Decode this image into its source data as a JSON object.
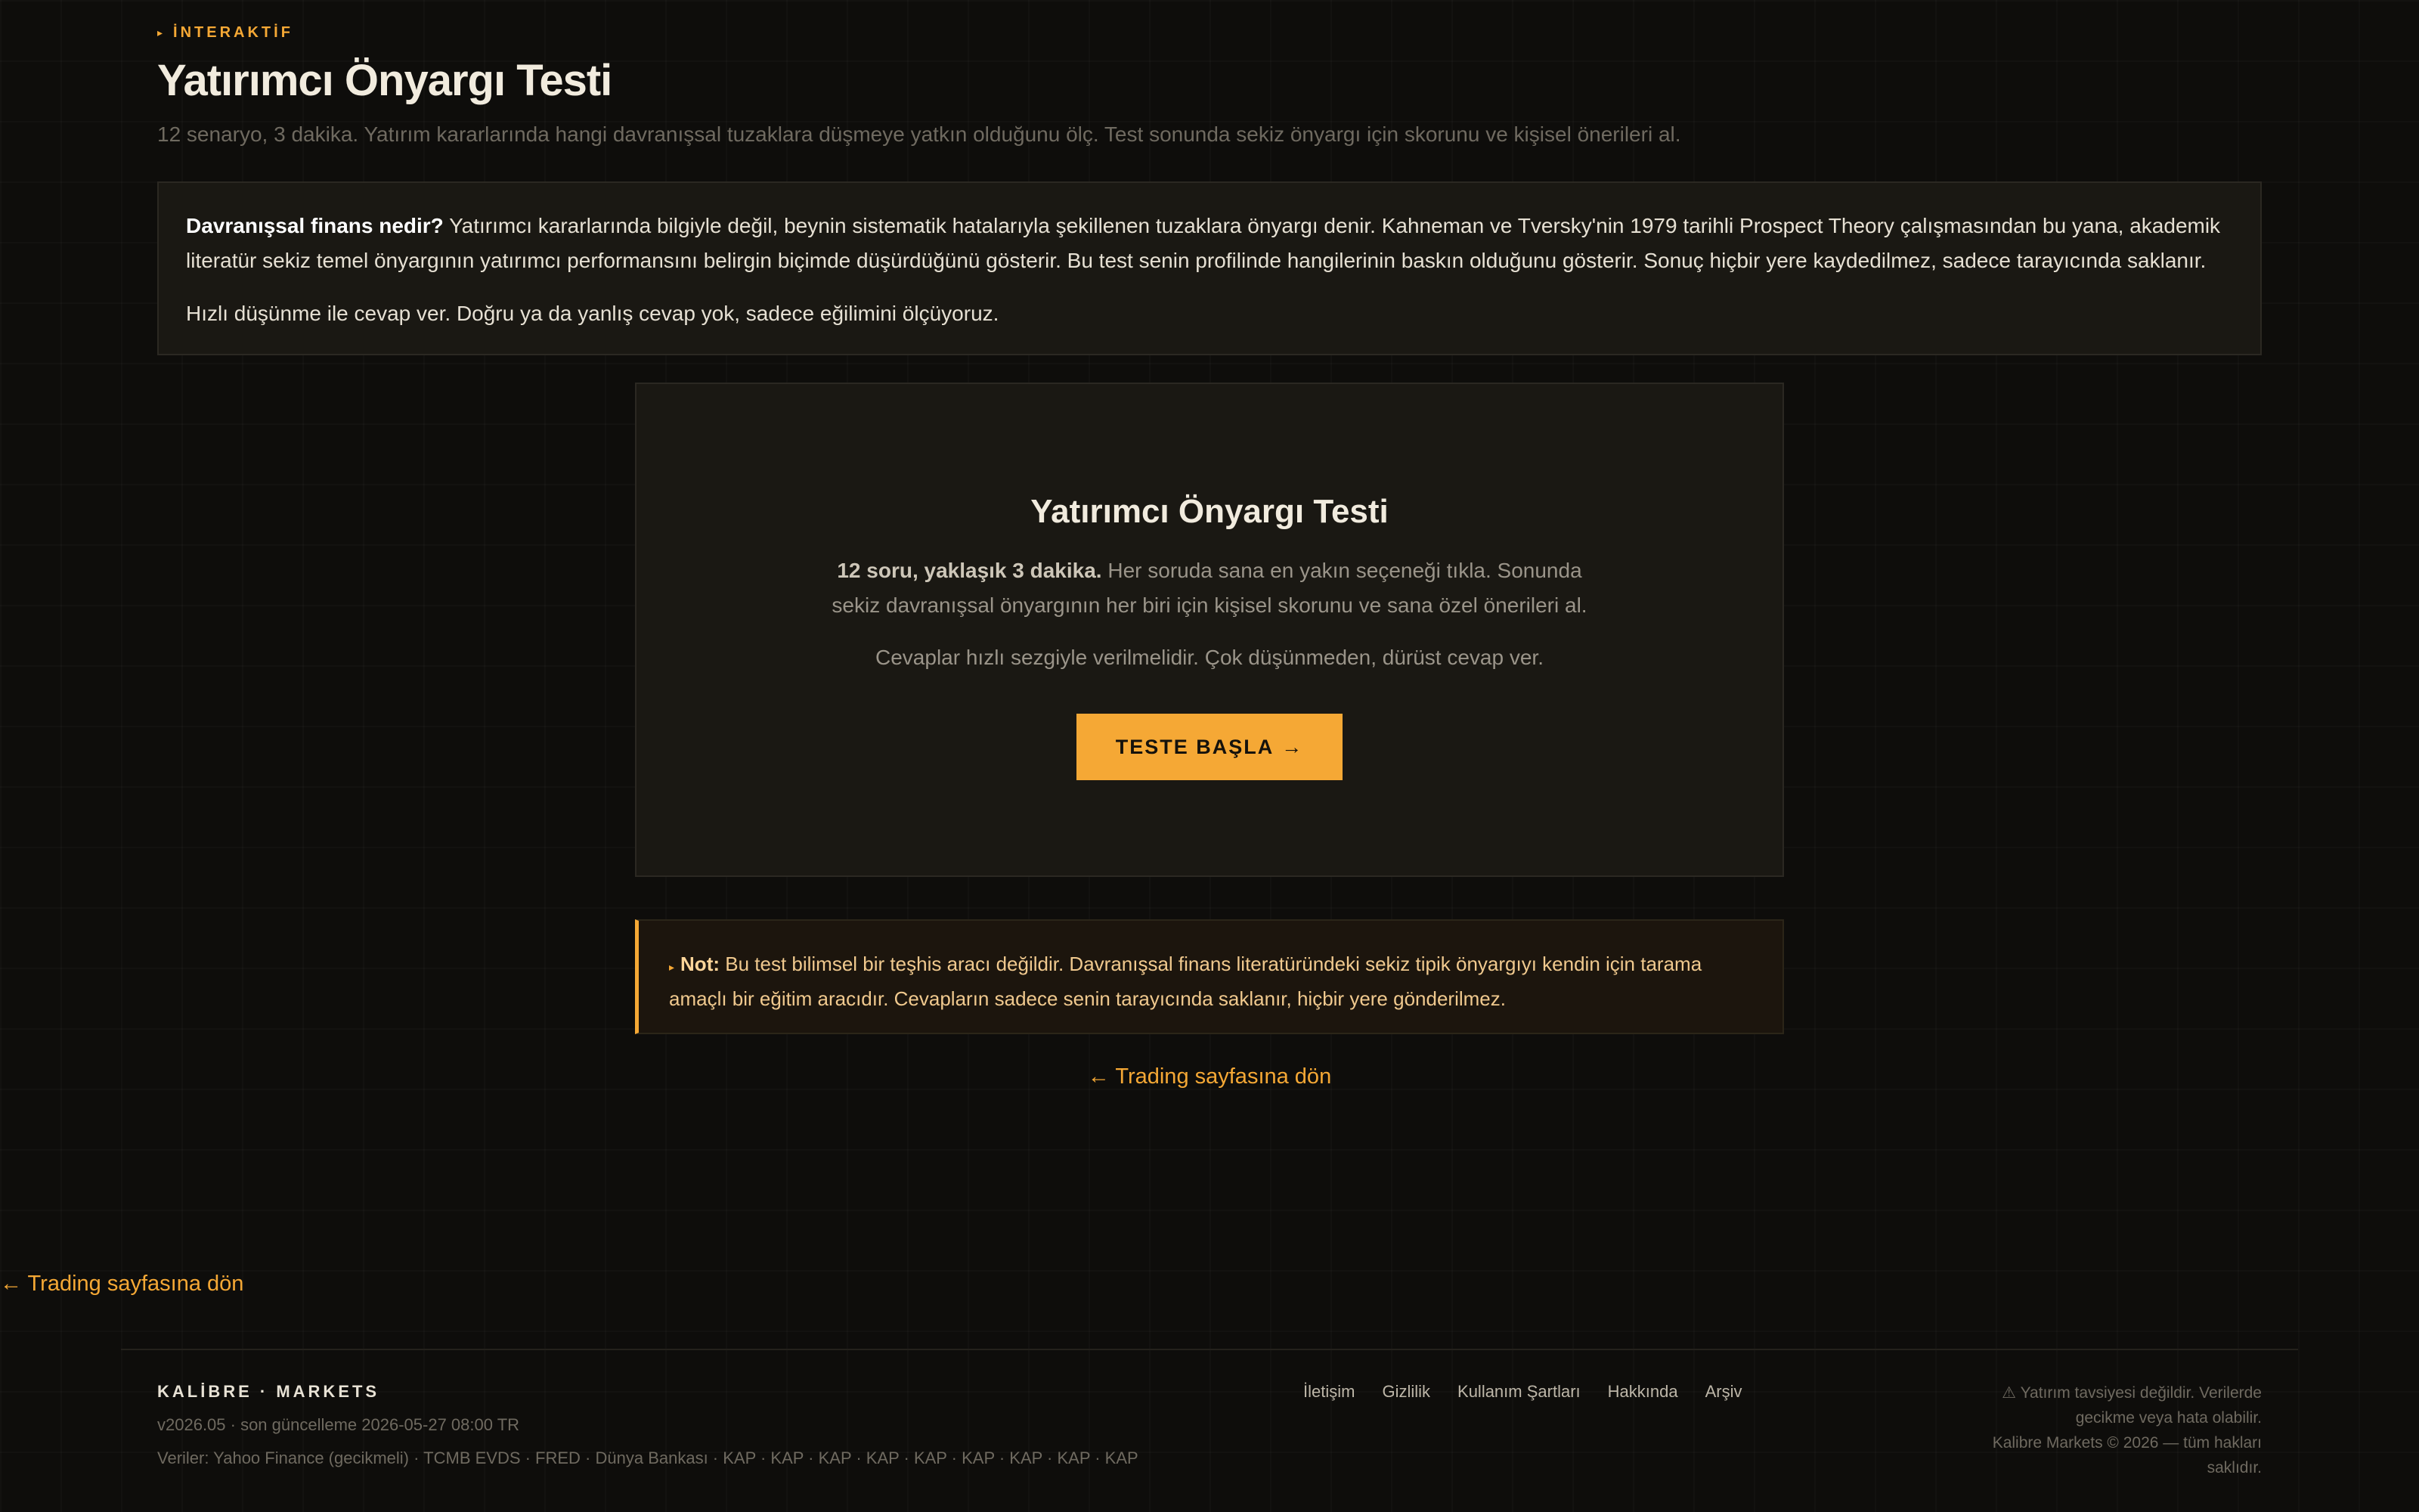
{
  "header": {
    "eyebrow_icon": "triangle-right-icon",
    "eyebrow": "İNTERAKTİF",
    "title": "Yatırımcı Önyargı Testi",
    "subtitle": "12 senaryo, 3 dakika. Yatırım kararlarında hangi davranışsal tuzaklara düşmeye yatkın olduğunu ölç. Test sonunda sekiz önyargı için skorunu ve kişisel önerileri al."
  },
  "intro": {
    "lead": "Davranışsal finans nedir?",
    "body": " Yatırımcı kararlarında bilgiyle değil, beynin sistematik hatalarıyla şekillenen tuzaklara önyargı denir. Kahneman ve Tversky'nin 1979 tarihli Prospect Theory çalışmasından bu yana, akademik literatür sekiz temel önyargının yatırımcı performansını belirgin biçimde düşürdüğünü gösterir. Bu test senin profilinde hangilerinin baskın olduğunu gösterir. Sonuç hiçbir yere kaydedilmez, sadece tarayıcında saklanır.",
    "second": "Hızlı düşünme ile cevap ver. Doğru ya da yanlış cevap yok, sadece eğilimini ölçüyoruz."
  },
  "card": {
    "title": "Yatırımcı Önyargı Testi",
    "desc_bold": "12 soru, yaklaşık 3 dakika.",
    "desc_rest": " Her soruda sana en yakın seçeneği tıkla. Sonunda sekiz davranışsal önyargının her biri için kişisel skorunu ve sana özel önerileri al.",
    "hint": "Cevaplar hızlı sezgiyle verilmelidir. Çok düşünmeden, dürüst cevap ver.",
    "button_label": "TESTE BAŞLA",
    "button_icon": "arrow-right-icon"
  },
  "note": {
    "label": "Not:",
    "text": " Bu test bilimsel bir teşhis aracı değildir. Davranışsal finans literatüründeki sekiz tipik önyargıyı kendin için tarama amaçlı bir eğitim aracıdır. Cevapların sadece senin tarayıcında saklanır, hiçbir yere gönderilmez."
  },
  "back_link": "← Trading sayfasına dön",
  "back_link_bottom": "← Trading sayfasına dön",
  "footer": {
    "brand": "KALİBRE · MARKETS",
    "version": "v2026.05 · son güncelleme 2026-05-27 08:00 TR",
    "sources": "Veriler: Yahoo Finance (gecikmeli) · TCMB EVDS · FRED · Dünya Bankası · KAP · KAP · KAP · KAP · KAP · KAP · KAP · KAP · KAP",
    "links": [
      "İletişim",
      "Gizlilik",
      "Kullanım Şartları",
      "Hakkında",
      "Arşiv"
    ],
    "disclaimer_line1": "⚠ Yatırım tavsiyesi değildir. Verilerde gecikme veya hata olabilir.",
    "disclaimer_line2": "Kalibre Markets © 2026 — tüm hakları saklıdır."
  },
  "colors": {
    "accent": "#f5a835",
    "background": "#0e0d0b",
    "panel": "#1a1813"
  }
}
